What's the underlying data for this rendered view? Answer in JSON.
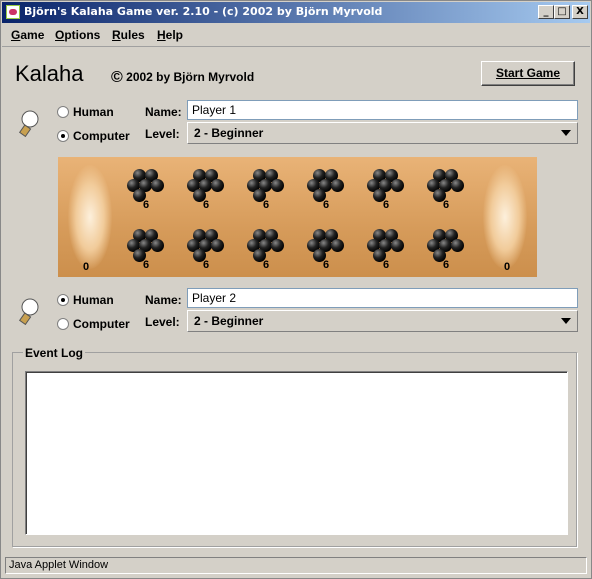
{
  "window": {
    "title": "Björn's Kalaha Game ver. 2.10 - (c) 2002 by Björn Myrvold",
    "minimize": "_",
    "maximize": "□",
    "close": "X"
  },
  "menu": [
    {
      "accel": "G",
      "rest": "ame"
    },
    {
      "accel": "O",
      "rest": "ptions"
    },
    {
      "accel": "R",
      "rest": "ules"
    },
    {
      "accel": "H",
      "rest": "elp"
    }
  ],
  "header": {
    "heading": "Kalaha",
    "copyright_symbol": "©",
    "copyright_text": "2002 by Björn Myrvold",
    "start_button": "Start Game"
  },
  "player1": {
    "radio_human": "Human",
    "radio_computer": "Computer",
    "selected": "computer",
    "name_label": "Name:",
    "name_value": "Player 1",
    "level_label": "Level:",
    "level_value": "2 - Beginner"
  },
  "player2": {
    "radio_human": "Human",
    "radio_computer": "Computer",
    "selected": "human",
    "name_label": "Name:",
    "name_value": "Player 2",
    "level_label": "Level:",
    "level_value": "2 - Beginner"
  },
  "board": {
    "top_pits": [
      "6",
      "6",
      "6",
      "6",
      "6",
      "6"
    ],
    "bottom_pits": [
      "6",
      "6",
      "6",
      "6",
      "6",
      "6"
    ],
    "left_store": "0",
    "right_store": "0"
  },
  "event_log": {
    "label": "Event Log"
  },
  "status": "Java Applet Window"
}
